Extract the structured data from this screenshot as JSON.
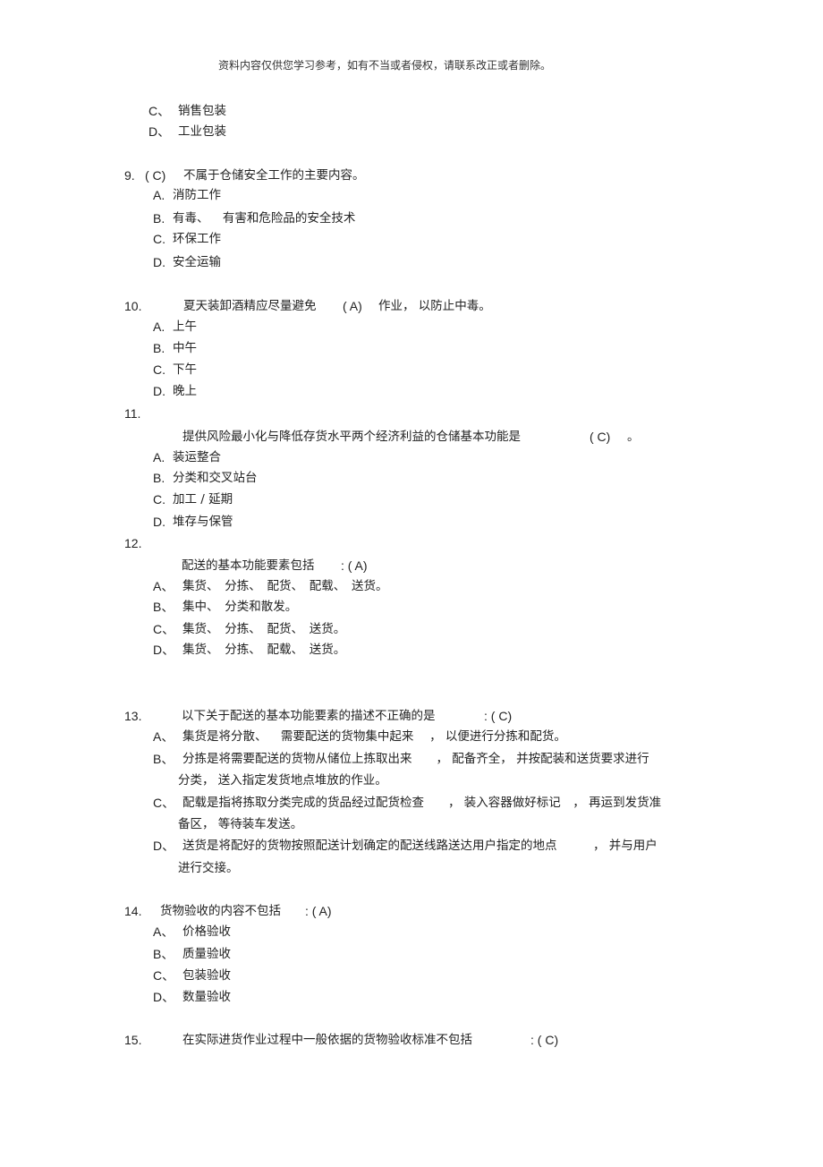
{
  "header": {
    "notice": "资料内容仅供您学习参考，如有不当或者侵权，请联系改正或者删除。"
  },
  "q8_tail": {
    "options": [
      {
        "label": "C、",
        "text": "销售包装"
      },
      {
        "label": "D、",
        "text": "工业包装"
      }
    ]
  },
  "q9": {
    "number": "9.",
    "answer": "( C)",
    "stem": "不属于仓储安全工作的主要内容。",
    "options": [
      {
        "label": "A.",
        "text": "消防工作"
      },
      {
        "label": "B.",
        "text": "有毒、　  有害和危险品的安全技术"
      },
      {
        "label": "C.",
        "text": "环保工作"
      },
      {
        "label": "D.",
        "text": "安全运输"
      }
    ]
  },
  "q10": {
    "number": "10.",
    "stem_a": "夏天装卸酒精应尽量避免",
    "answer": "( A)",
    "stem_b": "作业， 以防止中毒。",
    "options": [
      {
        "label": "A.",
        "text": "上午"
      },
      {
        "label": "B.",
        "text": "中午"
      },
      {
        "label": "C.",
        "text": "下午"
      },
      {
        "label": "D.",
        "text": "晚上"
      }
    ]
  },
  "q11": {
    "number": "11.",
    "stem": "提供风险最小化与降低存货水平两个经济利益的仓储基本功能是",
    "answer": "( C)",
    "end": "。",
    "options": [
      {
        "label": "A.",
        "text": "装运整合"
      },
      {
        "label": "B.",
        "text": "分类和交叉站台"
      },
      {
        "label": "C.",
        "text": "加工 / 延期"
      },
      {
        "label": "D.",
        "text": "堆存与保管"
      }
    ]
  },
  "q12": {
    "number": "12.",
    "stem": "配送的基本功能要素包括",
    "answer": ": ( A)",
    "options": [
      {
        "label": "A、",
        "text": "集货、　分拣、　配货、　配载、　送货。"
      },
      {
        "label": "B、",
        "text": "集中、　分类和散发。"
      },
      {
        "label": "C、",
        "text": "集货、　分拣、　配货、　送货。"
      },
      {
        "label": "D、",
        "text": "集货、　分拣、　配载、　送货。"
      }
    ]
  },
  "q13": {
    "number": "13.",
    "stem": "以下关于配送的基本功能要素的描述不正确的是",
    "answer": ": ( C)",
    "options": [
      {
        "label": "A、",
        "lines": [
          "集货是将分散、　  需要配送的货物集中起来　 ， 以便进行分拣和配货。"
        ]
      },
      {
        "label": "B、",
        "lines": [
          "分拣是将需要配送的货物从储位上拣取出来　　， 配备齐全， 并按配装和送货要求进行",
          "分类， 送入指定发货地点堆放的作业。"
        ]
      },
      {
        "label": "C、",
        "lines": [
          "配载是指将拣取分类完成的货品经过配货检查　　， 装入容器做好标记　， 再运到发货准",
          "备区， 等待装车发送。"
        ]
      },
      {
        "label": "D、",
        "lines": [
          "送货是将配好的货物按照配送计划确定的配送线路送达用户指定的地点　　　， 并与用户",
          "进行交接。"
        ]
      }
    ]
  },
  "q14": {
    "number": "14.",
    "stem": "货物验收的内容不包括",
    "answer": ": ( A)",
    "options": [
      {
        "label": "A、",
        "text": "价格验收"
      },
      {
        "label": "B、",
        "text": "质量验收"
      },
      {
        "label": "C、",
        "text": "包装验收"
      },
      {
        "label": "D、",
        "text": "数量验收"
      }
    ]
  },
  "q15": {
    "number": "15.",
    "stem": "在实际进货作业过程中一般依据的货物验收标准不包括",
    "answer": ": ( C)"
  }
}
